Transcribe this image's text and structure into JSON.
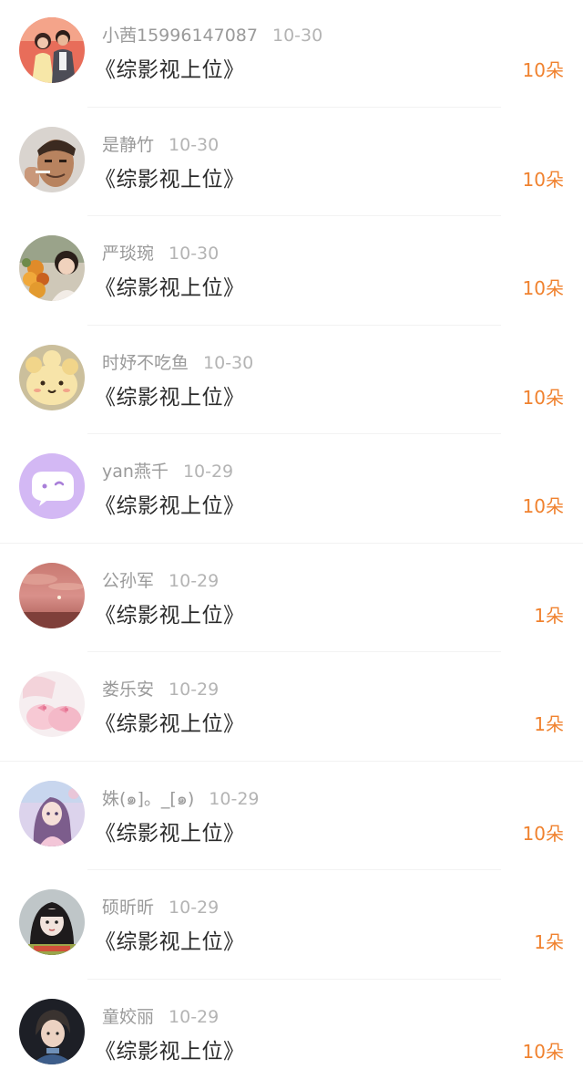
{
  "gifts": [
    {
      "user": "小茜15996147087",
      "date": "10-30",
      "book": "《综影视上位》",
      "amount": "10朵",
      "avatar": "avatar-couple-photo"
    },
    {
      "user": "是静竹",
      "date": "10-30",
      "book": "《综影视上位》",
      "amount": "10朵",
      "avatar": "avatar-man-portrait"
    },
    {
      "user": "严琰琬",
      "date": "10-30",
      "book": "《综影视上位》",
      "amount": "10朵",
      "avatar": "avatar-girl-with-flowers"
    },
    {
      "user": "时妤不吃鱼",
      "date": "10-30",
      "book": "《综影视上位》",
      "amount": "10朵",
      "avatar": "avatar-cartoon-bear"
    },
    {
      "user": "yan燕千",
      "date": "10-29",
      "book": "《综影视上位》",
      "amount": "10朵",
      "avatar": "avatar-default-chat"
    },
    {
      "user": "公孙军",
      "date": "10-29",
      "book": "《综影视上位》",
      "amount": "1朵",
      "avatar": "avatar-sunset-sky"
    },
    {
      "user": "娄乐安",
      "date": "10-29",
      "book": "《综影视上位》",
      "amount": "1朵",
      "avatar": "avatar-pink-slippers"
    },
    {
      "user": "姝(๑]。_[๑)",
      "date": "10-29",
      "book": "《综影视上位》",
      "amount": "10朵",
      "avatar": "avatar-anime-girl"
    },
    {
      "user": "硕昕昕",
      "date": "10-29",
      "book": "《综影视上位》",
      "amount": "1朵",
      "avatar": "avatar-girl-portrait"
    },
    {
      "user": "童姣丽",
      "date": "10-29",
      "book": "《综影视上位》",
      "amount": "10朵",
      "avatar": "avatar-boy-portrait"
    }
  ],
  "colors": {
    "accent": "#f0822f",
    "username": "#9a9a9a",
    "title": "#2b2b2b"
  }
}
